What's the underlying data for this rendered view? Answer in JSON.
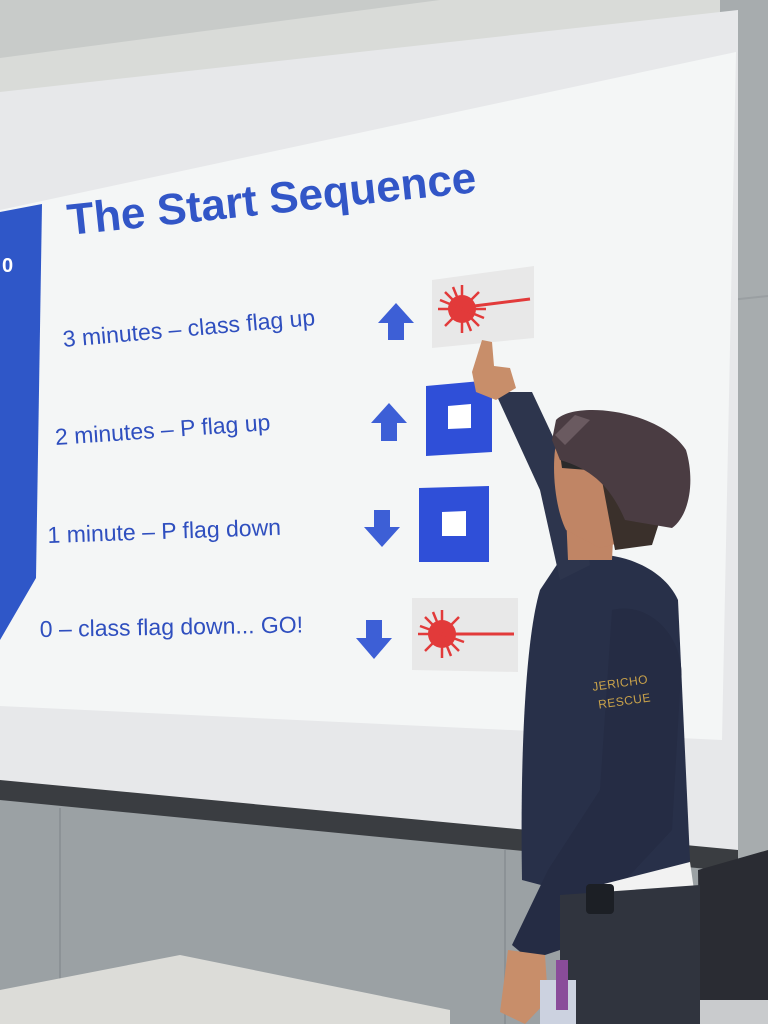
{
  "slide": {
    "title": "The Start Sequence",
    "steps": [
      {
        "text": "3 minutes – class flag up",
        "arrow": "up-arrow-icon",
        "flag": "class-flag-icon"
      },
      {
        "text": "2 minutes – P flag up",
        "arrow": "up-arrow-icon",
        "flag": "p-flag-icon"
      },
      {
        "text": "1 minute – P flag down",
        "arrow": "down-arrow-icon",
        "flag": "p-flag-icon"
      },
      {
        "text": "0 – class flag down... GO!",
        "arrow": "down-arrow-icon",
        "flag": "class-flag-icon"
      }
    ]
  },
  "patch": {
    "line1": "JERICHO",
    "line2": "RESCUE"
  },
  "colors": {
    "slide_text": "#3256c7",
    "arrow": "#3d5fd6",
    "p_flag": "#2f4fd8",
    "class_flag": "#e23a3a",
    "shirt": "#283049",
    "cap": "#4a3c42",
    "wall": "#8f969c"
  }
}
